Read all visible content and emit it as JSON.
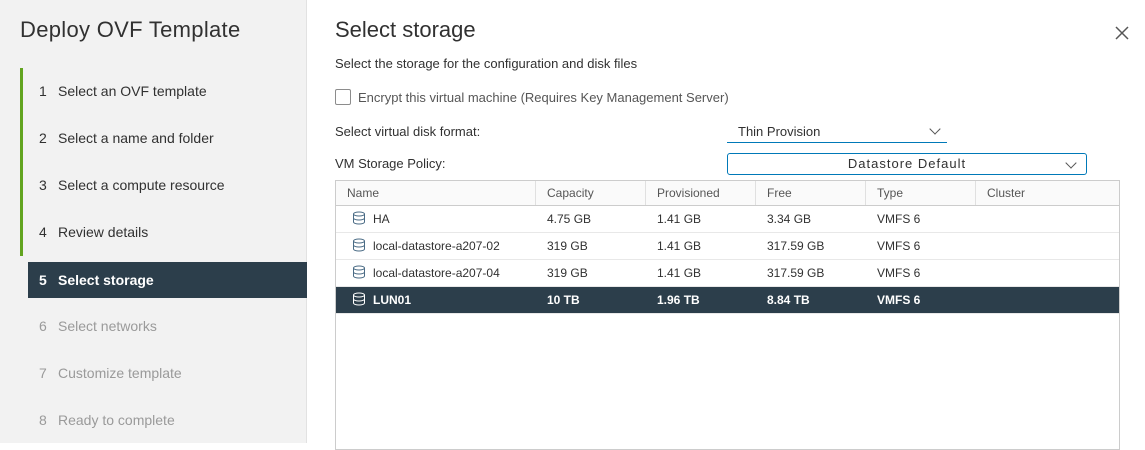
{
  "wizard": {
    "title": "Deploy OVF Template",
    "steps": [
      {
        "num": "1",
        "label": "Select an OVF template"
      },
      {
        "num": "2",
        "label": "Select a name and folder"
      },
      {
        "num": "3",
        "label": "Select a compute resource"
      },
      {
        "num": "4",
        "label": "Review details"
      },
      {
        "num": "5",
        "label": "Select storage"
      },
      {
        "num": "6",
        "label": "Select networks"
      },
      {
        "num": "7",
        "label": "Customize template"
      },
      {
        "num": "8",
        "label": "Ready to complete"
      }
    ]
  },
  "page": {
    "title": "Select storage",
    "subtitle": "Select the storage for the configuration and disk files",
    "encrypt_label": "Encrypt this virtual machine (Requires Key Management Server)",
    "disk_format_label": "Select virtual disk format:",
    "disk_format_value": "Thin Provision",
    "storage_policy_label": "VM Storage Policy:",
    "storage_policy_value": "Datastore Default"
  },
  "grid": {
    "columns": [
      "Name",
      "Capacity",
      "Provisioned",
      "Free",
      "Type",
      "Cluster"
    ],
    "rows": [
      {
        "name": "HA",
        "capacity": "4.75 GB",
        "provisioned": "1.41 GB",
        "free": "3.34 GB",
        "type": "VMFS 6",
        "cluster": ""
      },
      {
        "name": "local-datastore-a207-02",
        "capacity": "319 GB",
        "provisioned": "1.41 GB",
        "free": "317.59 GB",
        "type": "VMFS 6",
        "cluster": ""
      },
      {
        "name": "local-datastore-a207-04",
        "capacity": "319 GB",
        "provisioned": "1.41 GB",
        "free": "317.59 GB",
        "type": "VMFS 6",
        "cluster": ""
      },
      {
        "name": "LUN01",
        "capacity": "10 TB",
        "provisioned": "1.96 TB",
        "free": "8.84 TB",
        "type": "VMFS 6",
        "cluster": ""
      }
    ],
    "selected_row": "LUN01"
  },
  "icons": {
    "close": "close-icon",
    "datastore": "datastore-icon",
    "dropdown": "chevron-down-icon"
  },
  "colors": {
    "accent": "#0079b8",
    "selected_bg": "#2c3e4b",
    "done_bar": "#62a420"
  }
}
